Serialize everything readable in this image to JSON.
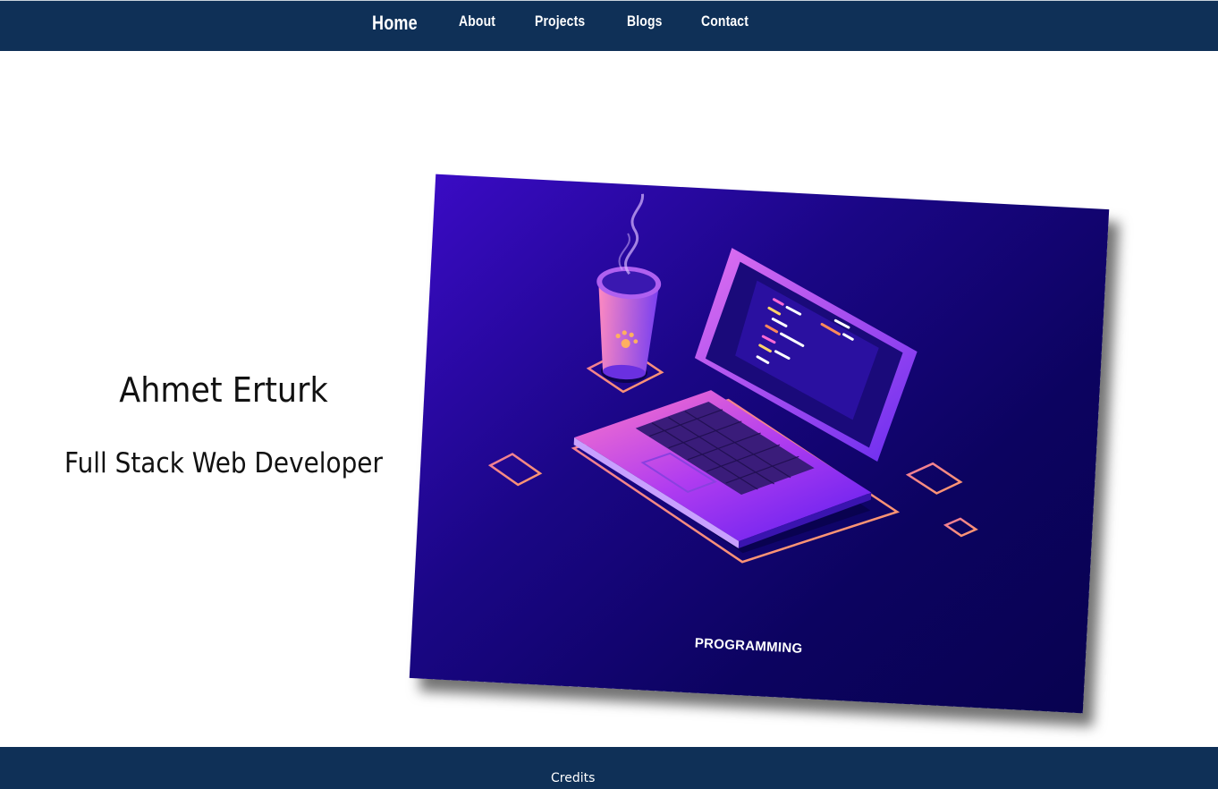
{
  "nav": {
    "home": "Home",
    "about": "About",
    "projects": "Projects",
    "blogs": "Blogs",
    "contact": "Contact"
  },
  "hero": {
    "name": "Ahmet Erturk",
    "role": "Full Stack Web Developer",
    "image_caption": "PROGRAMMING"
  },
  "footer": {
    "credits": "Credits"
  },
  "colors": {
    "navbar_bg": "#0f3057",
    "footer_bg": "#0f3057",
    "card_bg_start": "#3a0bc4",
    "card_bg_end": "#080250",
    "text_dark": "#111111"
  }
}
